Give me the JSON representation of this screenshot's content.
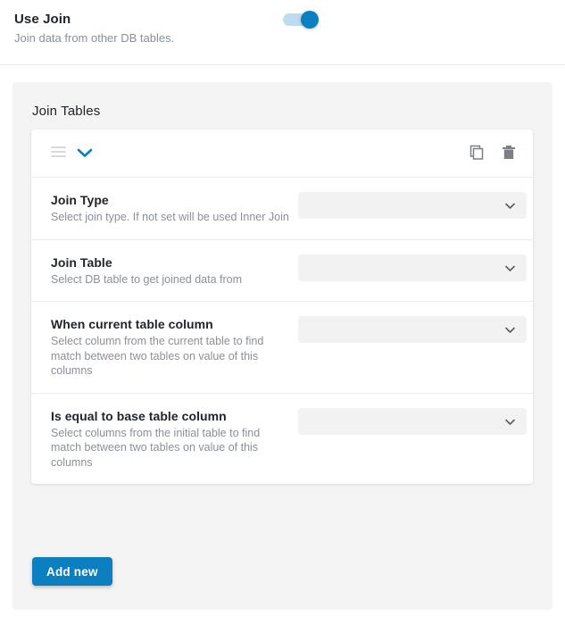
{
  "top_section": {
    "title": "Use Join",
    "description": "Join data from other DB tables.",
    "toggle": {
      "name": "use-join-toggle",
      "state": "on",
      "track_color": "#bcdcf0",
      "knob_color": "#0b7fc0"
    }
  },
  "panel": {
    "title": "Join Tables",
    "background": "#f4f4f4"
  },
  "card": {
    "header": {
      "drag_handle_icon": "drag-handle-icon",
      "collapse_icon": "chevron-down-icon",
      "collapse_icon_color": "#0b7fc0",
      "duplicate_icon": "copy-icon",
      "delete_icon": "trash-icon",
      "action_icon_color": "#6c757d"
    },
    "rows": [
      {
        "label": "Join Type",
        "description": "Select join type. If not set will be used Inner Join",
        "select": {
          "name": "join-type-select",
          "value": "",
          "placeholder": ""
        }
      },
      {
        "label": "Join Table",
        "description": "Select DB table to get joined data from",
        "select": {
          "name": "join-table-select",
          "value": "",
          "placeholder": ""
        }
      },
      {
        "label": "When current table column",
        "description": "Select column from the current table to find match between two tables on value of this columns",
        "select": {
          "name": "current-table-column-select",
          "value": "",
          "placeholder": ""
        }
      },
      {
        "label": "Is equal to base table column",
        "description": "Select columns from the initial table to find match between two tables on value of this columns",
        "select": {
          "name": "base-table-column-select",
          "value": "",
          "placeholder": ""
        }
      }
    ]
  },
  "actions": {
    "add_new_label": "Add new",
    "add_new_color": "#0b7fc0"
  }
}
